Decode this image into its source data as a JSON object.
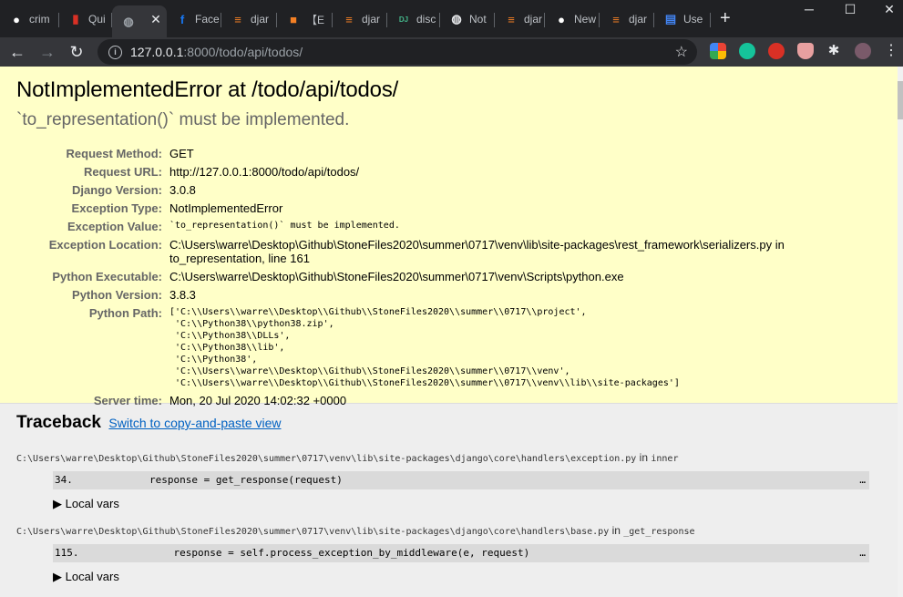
{
  "browser": {
    "tabs": [
      {
        "label": "crim",
        "icon": "github-icon",
        "color": "#ffffff"
      },
      {
        "label": "Qui",
        "icon": "quiz-icon",
        "color": "#d93025"
      },
      {
        "label": "",
        "icon": "globe-icon",
        "color": "#9aa0a6",
        "active": true
      },
      {
        "label": "Face",
        "icon": "facebook-icon",
        "color": "#1877f2"
      },
      {
        "label": "djar",
        "icon": "stackoverflow-icon",
        "color": "#f48024"
      },
      {
        "label": "【E",
        "icon": "box-icon",
        "color": "#f48024"
      },
      {
        "label": "djar",
        "icon": "stackoverflow-icon",
        "color": "#f48024"
      },
      {
        "label": "disc",
        "icon": "djs-icon",
        "color": "#44b78b"
      },
      {
        "label": "Not",
        "icon": "globe-icon",
        "color": "#e8eaed"
      },
      {
        "label": "djar",
        "icon": "stackoverflow-icon",
        "color": "#f48024"
      },
      {
        "label": "New",
        "icon": "github-icon",
        "color": "#ffffff"
      },
      {
        "label": "djar",
        "icon": "stackoverflow-icon",
        "color": "#f48024"
      },
      {
        "label": "Use",
        "icon": "docs-icon",
        "color": "#4285f4"
      }
    ],
    "url": {
      "host": "127.0.0.1",
      "path": ":8000/todo/api/todos/"
    }
  },
  "error": {
    "title": "NotImplementedError at /todo/api/todos/",
    "message": "`to_representation()` must be implemented.",
    "meta": {
      "request_method_label": "Request Method:",
      "request_method": "GET",
      "request_url_label": "Request URL:",
      "request_url": "http://127.0.0.1:8000/todo/api/todos/",
      "django_version_label": "Django Version:",
      "django_version": "3.0.8",
      "exception_type_label": "Exception Type:",
      "exception_type": "NotImplementedError",
      "exception_value_label": "Exception Value:",
      "exception_value": "`to_representation()` must be implemented.",
      "exception_location_label": "Exception Location:",
      "exception_location": "C:\\Users\\warre\\Desktop\\Github\\StoneFiles2020\\summer\\0717\\venv\\lib\\site-packages\\rest_framework\\serializers.py in to_representation, line 161",
      "python_executable_label": "Python Executable:",
      "python_executable": "C:\\Users\\warre\\Desktop\\Github\\StoneFiles2020\\summer\\0717\\venv\\Scripts\\python.exe",
      "python_version_label": "Python Version:",
      "python_version": "3.8.3",
      "python_path_label": "Python Path:",
      "python_path": "['C:\\\\Users\\\\warre\\\\Desktop\\\\Github\\\\StoneFiles2020\\\\summer\\\\0717\\\\project',\n 'C:\\\\Python38\\\\python38.zip',\n 'C:\\\\Python38\\\\DLLs',\n 'C:\\\\Python38\\\\lib',\n 'C:\\\\Python38',\n 'C:\\\\Users\\\\warre\\\\Desktop\\\\Github\\\\StoneFiles2020\\\\summer\\\\0717\\\\venv',\n 'C:\\\\Users\\\\warre\\\\Desktop\\\\Github\\\\StoneFiles2020\\\\summer\\\\0717\\\\venv\\\\lib\\\\site-packages']",
      "server_time_label": "Server time:",
      "server_time": "Mon, 20 Jul 2020 14:02:32 +0000"
    }
  },
  "traceback": {
    "title": "Traceback",
    "switch_link": "Switch to copy-and-paste view",
    "in_word": "in",
    "local_vars": "▶ Local vars",
    "frames": [
      {
        "file": "C:\\Users\\warre\\Desktop\\Github\\StoneFiles2020\\summer\\0717\\venv\\lib\\site-packages\\django\\core\\handlers\\exception.py",
        "function": "inner",
        "lineno": "34.",
        "code": "response = get_response(request)",
        "ellipsis": "…"
      },
      {
        "file": "C:\\Users\\warre\\Desktop\\Github\\StoneFiles2020\\summer\\0717\\venv\\lib\\site-packages\\django\\core\\handlers\\base.py",
        "function": "_get_response",
        "lineno": "115.",
        "code": "    response = self.process_exception_by_middleware(e, request)",
        "ellipsis": "…"
      }
    ]
  }
}
